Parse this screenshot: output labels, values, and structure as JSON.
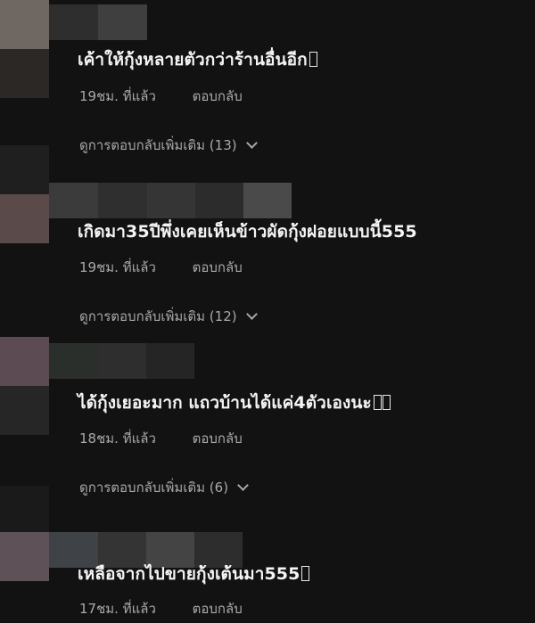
{
  "comments": [
    {
      "text": "เค้าให้กุ้งหลายตัวกว่าร้านอื่นอีก",
      "box_glyphs": 1,
      "time": "19ชม. ที่แล้ว",
      "reply": "ตอบกลับ",
      "more": "ดูการตอบกลับเพิ่มเติม (13)"
    },
    {
      "text": "เกิดมา35ปีพึ่งเคยเห็นข้าวผัดกุ้งฝอยแบบนี้555",
      "box_glyphs": 0,
      "time": "19ชม. ที่แล้ว",
      "reply": "ตอบกลับ",
      "more": "ดูการตอบกลับเพิ่มเติม (12)"
    },
    {
      "text": "ได้กุ้งเยอะมาก แถวบ้านได้แค่4ตัวเองนะ",
      "box_glyphs": 2,
      "time": "18ชม. ที่แล้ว",
      "reply": "ตอบกลับ",
      "more": "ดูการตอบกลับเพิ่มเติม (6)"
    },
    {
      "text": "เหลือจากไปขายกุ้งเต้นมา555",
      "box_glyphs": 1,
      "time": "17ชม. ที่แล้ว",
      "reply": "ตอบกลับ",
      "more": ""
    }
  ],
  "colors": {
    "background": "#121212",
    "text": "#f4f4f4",
    "meta": "#a9a9a9"
  }
}
